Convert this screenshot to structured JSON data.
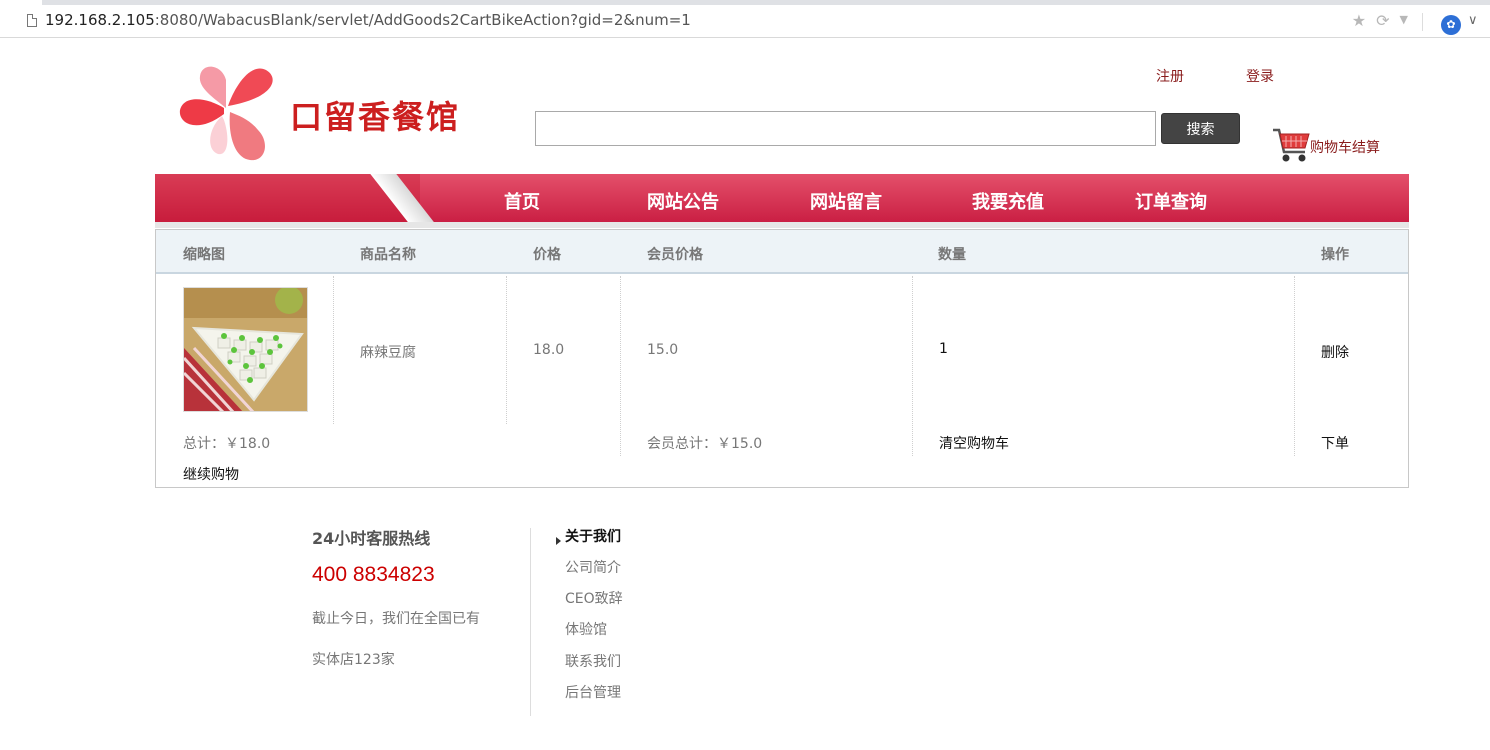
{
  "browser": {
    "url_host": "192.168.2.105",
    "url_rest": ":8080/WabacusBlank/servlet/AddGoods2CartBikeAction?gid=2&num=1"
  },
  "header": {
    "logo_text": "口留香餐馆",
    "register": "注册",
    "login": "登录",
    "search_placeholder": "",
    "search_button": "搜索",
    "cart_checkout": "购物车结算"
  },
  "nav": {
    "items": [
      {
        "label": "首页"
      },
      {
        "label": "网站公告"
      },
      {
        "label": "网站留言"
      },
      {
        "label": "我要充值"
      },
      {
        "label": "订单查询"
      }
    ]
  },
  "cart": {
    "headers": {
      "thumb": "缩略图",
      "name": "商品名称",
      "price": "价格",
      "member_price": "会员价格",
      "quantity": "数量",
      "action": "操作"
    },
    "rows": [
      {
        "name": "麻辣豆腐",
        "price": "18.0",
        "member_price": "15.0",
        "quantity": "1",
        "action": "删除"
      }
    ],
    "total": "总计：￥18.0",
    "member_total": "会员总计：￥15.0",
    "clear": "清空购物车",
    "order": "下单",
    "continue": "继续购物"
  },
  "footer": {
    "hotline_title": "24小时客服热线",
    "phone": "400 8834823",
    "text_line1": "截止今日，我们在全国已有",
    "text_line2": "实体店123家",
    "about_heading": "关于我们",
    "links": [
      {
        "label": "公司简介"
      },
      {
        "label": "CEO致辞"
      },
      {
        "label": "体验馆"
      },
      {
        "label": "联系我们"
      },
      {
        "label": "后台管理"
      }
    ]
  },
  "colors": {
    "accent": "#c91d42",
    "link_red": "#8a1c1c",
    "phone_red": "#cc0000"
  }
}
